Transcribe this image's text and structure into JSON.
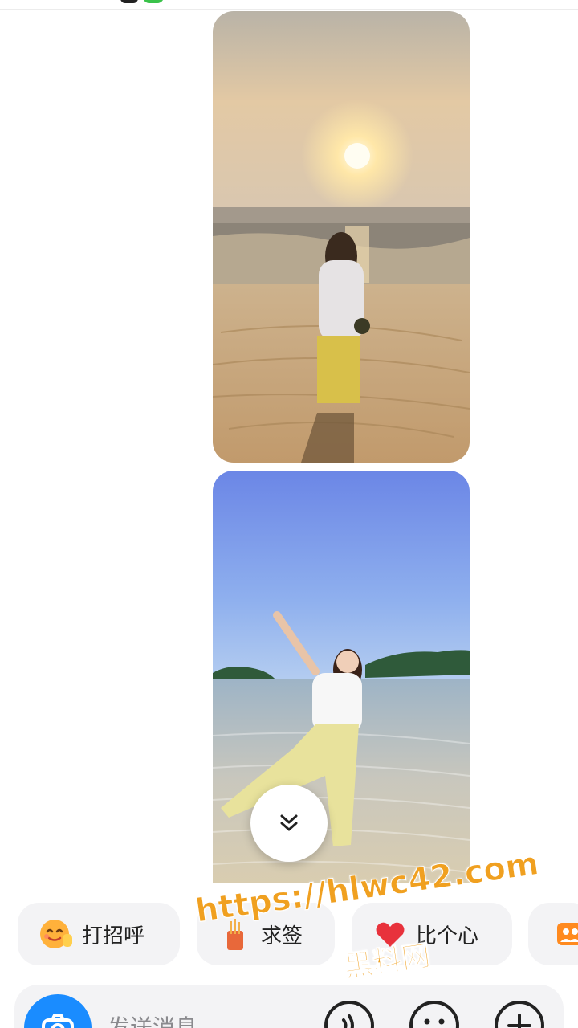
{
  "status_bar": {},
  "chat": {
    "photos": [
      {
        "icon": "beach-sunset-photo"
      },
      {
        "icon": "beach-pose-photo"
      }
    ],
    "scroll_icon": "double-chevron-down-icon"
  },
  "quick_replies": [
    {
      "label": "打招呼",
      "icon": "wave-emoji-icon"
    },
    {
      "label": "求签",
      "icon": "fortune-stick-icon"
    },
    {
      "label": "比个心",
      "icon": "heart-icon"
    },
    {
      "label": "",
      "icon": "group-icon"
    }
  ],
  "watermark": {
    "url": "https://hlwc42.com",
    "name": "黑料网"
  },
  "input_bar": {
    "placeholder": "发送消息",
    "camera_icon": "camera-icon",
    "voice_icon": "voice-icon",
    "emoji_icon": "emoji-icon",
    "plus_icon": "plus-icon"
  },
  "colors": {
    "accent": "#1a8cff",
    "chip_bg": "#f3f3f5",
    "watermark": "#f0a020"
  }
}
